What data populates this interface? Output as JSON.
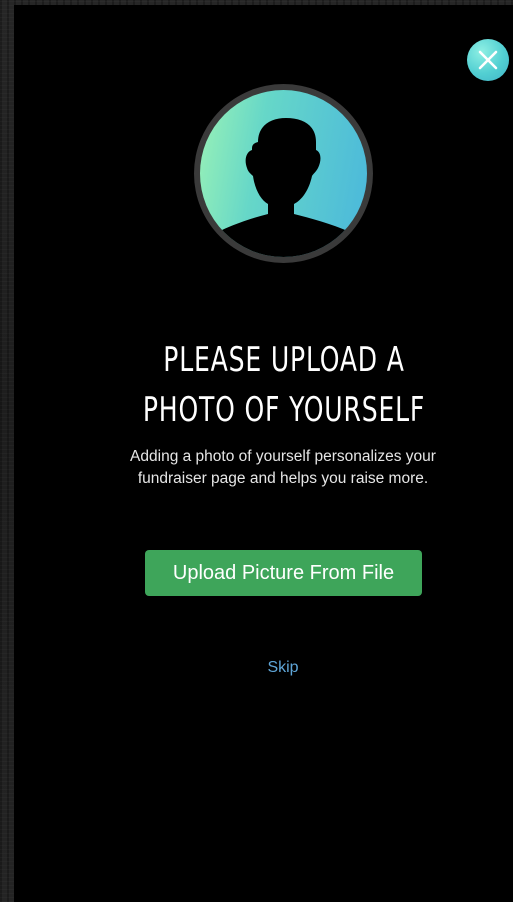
{
  "modal": {
    "close_icon": "close-icon",
    "avatar_icon": "person-silhouette-icon",
    "headline": "PLEASE UPLOAD A PHOTO OF YOURSELF",
    "description": "Adding a photo of yourself personalizes your fundraiser page and helps you raise more.",
    "upload_button_label": "Upload Picture From File",
    "skip_label": "Skip"
  },
  "colors": {
    "modal_background": "#000000",
    "accent_teal": "#52cfd2",
    "upload_button": "#3ea55a",
    "skip_link": "#5fa6d8"
  }
}
